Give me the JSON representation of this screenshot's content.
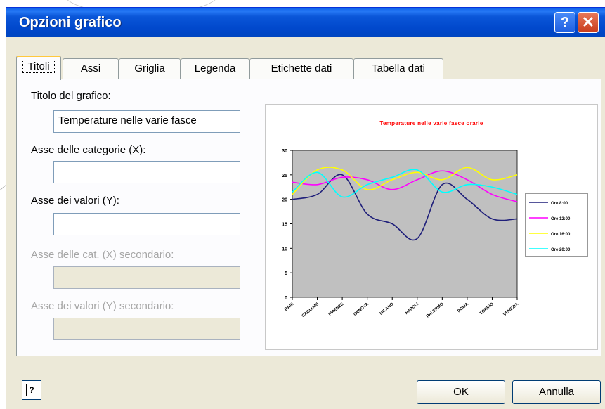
{
  "window": {
    "title": "Opzioni grafico",
    "help_glyph": "?",
    "close_glyph": "✕"
  },
  "tabs": [
    {
      "label": "Titoli",
      "active": true
    },
    {
      "label": "Assi"
    },
    {
      "label": "Griglia"
    },
    {
      "label": "Legenda"
    },
    {
      "label": "Etichette dati"
    },
    {
      "label": "Tabella dati"
    }
  ],
  "form": {
    "chart_title_label": "Titolo del grafico:",
    "chart_title_value": "Temperature nelle varie fasce",
    "x_axis_label": "Asse delle categorie (X):",
    "x_axis_value": "",
    "y_axis_label": "Asse dei valori (Y):",
    "y_axis_value": "",
    "x2_axis_label": "Asse delle cat. (X) secondario:",
    "y2_axis_label": "Asse dei valori (Y) secondario:"
  },
  "buttons": {
    "ok": "OK",
    "cancel": "Annulla",
    "help_glyph": "?"
  },
  "chart_data": {
    "type": "line",
    "title": "Temperature nelle varie fasce orarie",
    "categories": [
      "BARI",
      "CAGLIARI",
      "FIRENZE",
      "GENOVA",
      "MILANO",
      "NAPOLI",
      "PALERMO",
      "ROMA",
      "TORINO",
      "VENEZIA"
    ],
    "ylim": [
      0,
      30
    ],
    "yticks": [
      0,
      5,
      10,
      15,
      20,
      25,
      30
    ],
    "plot_background": "#c0c0c0",
    "series": [
      {
        "name": "Ore 8:00",
        "color": "#1f1f7a",
        "values": [
          20,
          21,
          25,
          17,
          15,
          12,
          23,
          20,
          16,
          16
        ]
      },
      {
        "name": "Ore 12:00",
        "color": "#ff00ff",
        "values": [
          23.5,
          23,
          24.5,
          24,
          22,
          24,
          25.8,
          24,
          21,
          19.5
        ]
      },
      {
        "name": "Ore 16:00",
        "color": "#ffff00",
        "values": [
          21,
          26,
          26,
          22,
          24,
          25.5,
          24,
          26.5,
          24,
          25
        ]
      },
      {
        "name": "Ore 20:00",
        "color": "#00ffff",
        "values": [
          21.5,
          25.5,
          20.5,
          23,
          24.5,
          26,
          21.5,
          23,
          22.5,
          21
        ]
      }
    ],
    "legend_position": "right"
  }
}
